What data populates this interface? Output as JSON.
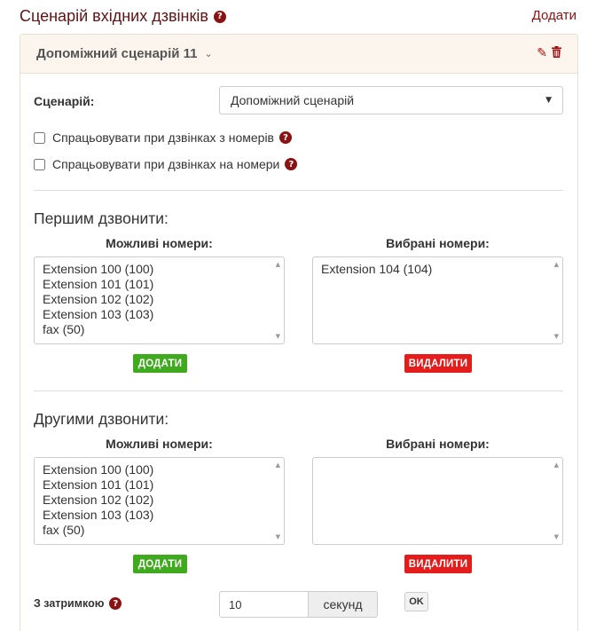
{
  "header": {
    "title": "Сценарій вхідних дзвінків",
    "add_label": "Додати"
  },
  "panel": {
    "title": "Допоміжний сценарій 11",
    "scenario_label": "Сценарій:",
    "scenario_value": "Допоміжний сценарій",
    "check_from_label": "Спрацьовувати при дзвінках з номерів",
    "check_to_label": "Спрацьовувати при дзвінках на номери"
  },
  "first": {
    "title": "Першим дзвонити:",
    "available_label": "Можливі номери:",
    "selected_label": "Вибрані номери:",
    "available": [
      "Extension 100 (100)",
      "Extension 101 (101)",
      "Extension 102 (102)",
      "Extension 103 (103)",
      "fax (50)"
    ],
    "selected": [
      "Extension 104 (104)"
    ],
    "add_button": "ДОДАТИ",
    "remove_button": "ВИДАЛИТИ"
  },
  "second": {
    "title": "Другими дзвонити:",
    "available_label": "Можливі номери:",
    "selected_label": "Вибрані номери:",
    "available": [
      "Extension 100 (100)",
      "Extension 101 (101)",
      "Extension 102 (102)",
      "Extension 103 (103)",
      "fax (50)"
    ],
    "selected": [],
    "add_button": "ДОДАТИ",
    "remove_button": "ВИДАЛИТИ"
  },
  "delay": {
    "label": "З затримкою",
    "value": "10",
    "unit": "секунд",
    "ok_label": "OK"
  },
  "icons": {
    "help": "question-circle-icon",
    "edit": "pencil-icon",
    "delete": "trash-icon",
    "collapse": "chevron-down-icon"
  },
  "colors": {
    "brand": "#8b1212",
    "add_button": "#3faa1e",
    "remove_button": "#e51c1c"
  }
}
